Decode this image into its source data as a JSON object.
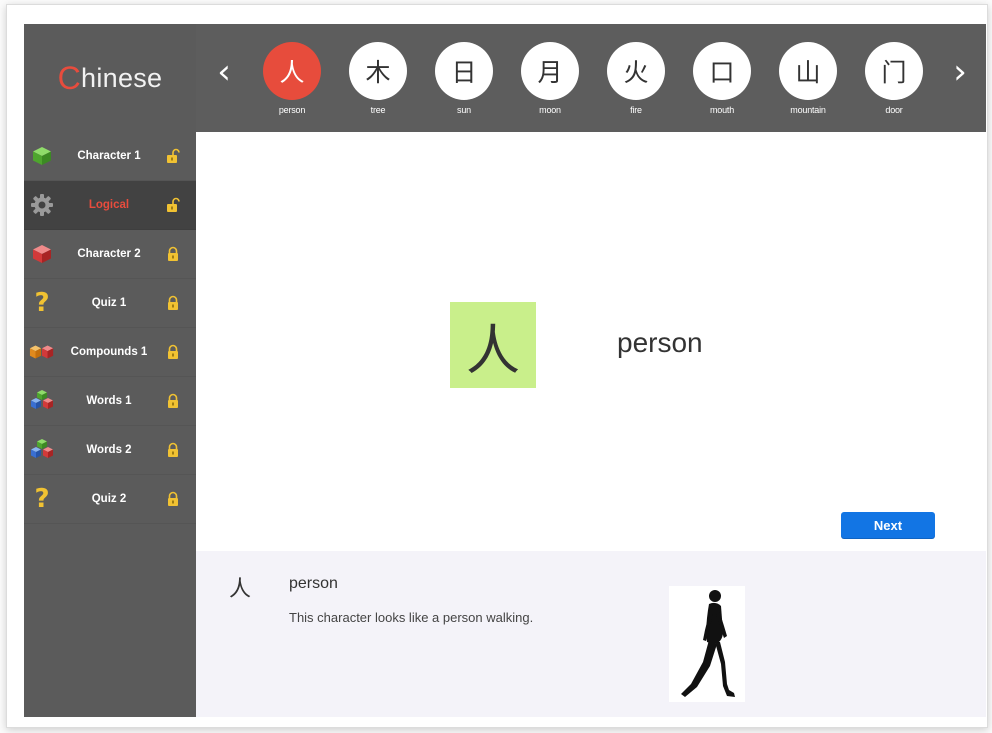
{
  "app": {
    "brand_first": "C",
    "brand_rest": "hinese"
  },
  "sidebar": {
    "items": [
      {
        "label": "Character 1",
        "icon": "green-cube-icon",
        "state": "unlocked"
      },
      {
        "label": "Logical",
        "icon": "gear-icon",
        "state": "unlocked",
        "active": true
      },
      {
        "label": "Character 2",
        "icon": "red-cube-icon",
        "state": "locked"
      },
      {
        "label": "Quiz 1",
        "icon": "question-mark-icon",
        "state": "locked"
      },
      {
        "label": "Compounds 1",
        "icon": "cubes-pair-icon",
        "state": "locked"
      },
      {
        "label": "Words 1",
        "icon": "cube-stack-icon",
        "state": "locked"
      },
      {
        "label": "Words 2",
        "icon": "cube-stack-icon",
        "state": "locked"
      },
      {
        "label": "Quiz 2",
        "icon": "question-mark-icon",
        "state": "locked"
      }
    ]
  },
  "topbar": {
    "prev_glyph": "‹",
    "next_glyph": "›",
    "characters": [
      {
        "char": "人",
        "label": "person",
        "active": true
      },
      {
        "char": "木",
        "label": "tree"
      },
      {
        "char": "日",
        "label": "sun"
      },
      {
        "char": "月",
        "label": "moon"
      },
      {
        "char": "火",
        "label": "fire"
      },
      {
        "char": "口",
        "label": "mouth"
      },
      {
        "char": "山",
        "label": "mountain"
      },
      {
        "char": "门",
        "label": "door"
      }
    ]
  },
  "main": {
    "character": "人",
    "meaning": "person",
    "next_label": "Next"
  },
  "info": {
    "character": "人",
    "word": "person",
    "description": "This character looks like a person walking.",
    "image_icon": "walking-person-silhouette"
  },
  "colors": {
    "accent_red": "#e74c3c",
    "highlight_green": "#c9ef8b",
    "button_blue": "#1275e4",
    "sidebar_bg": "#5b5b5b",
    "lock_gold": "#f1c232"
  }
}
